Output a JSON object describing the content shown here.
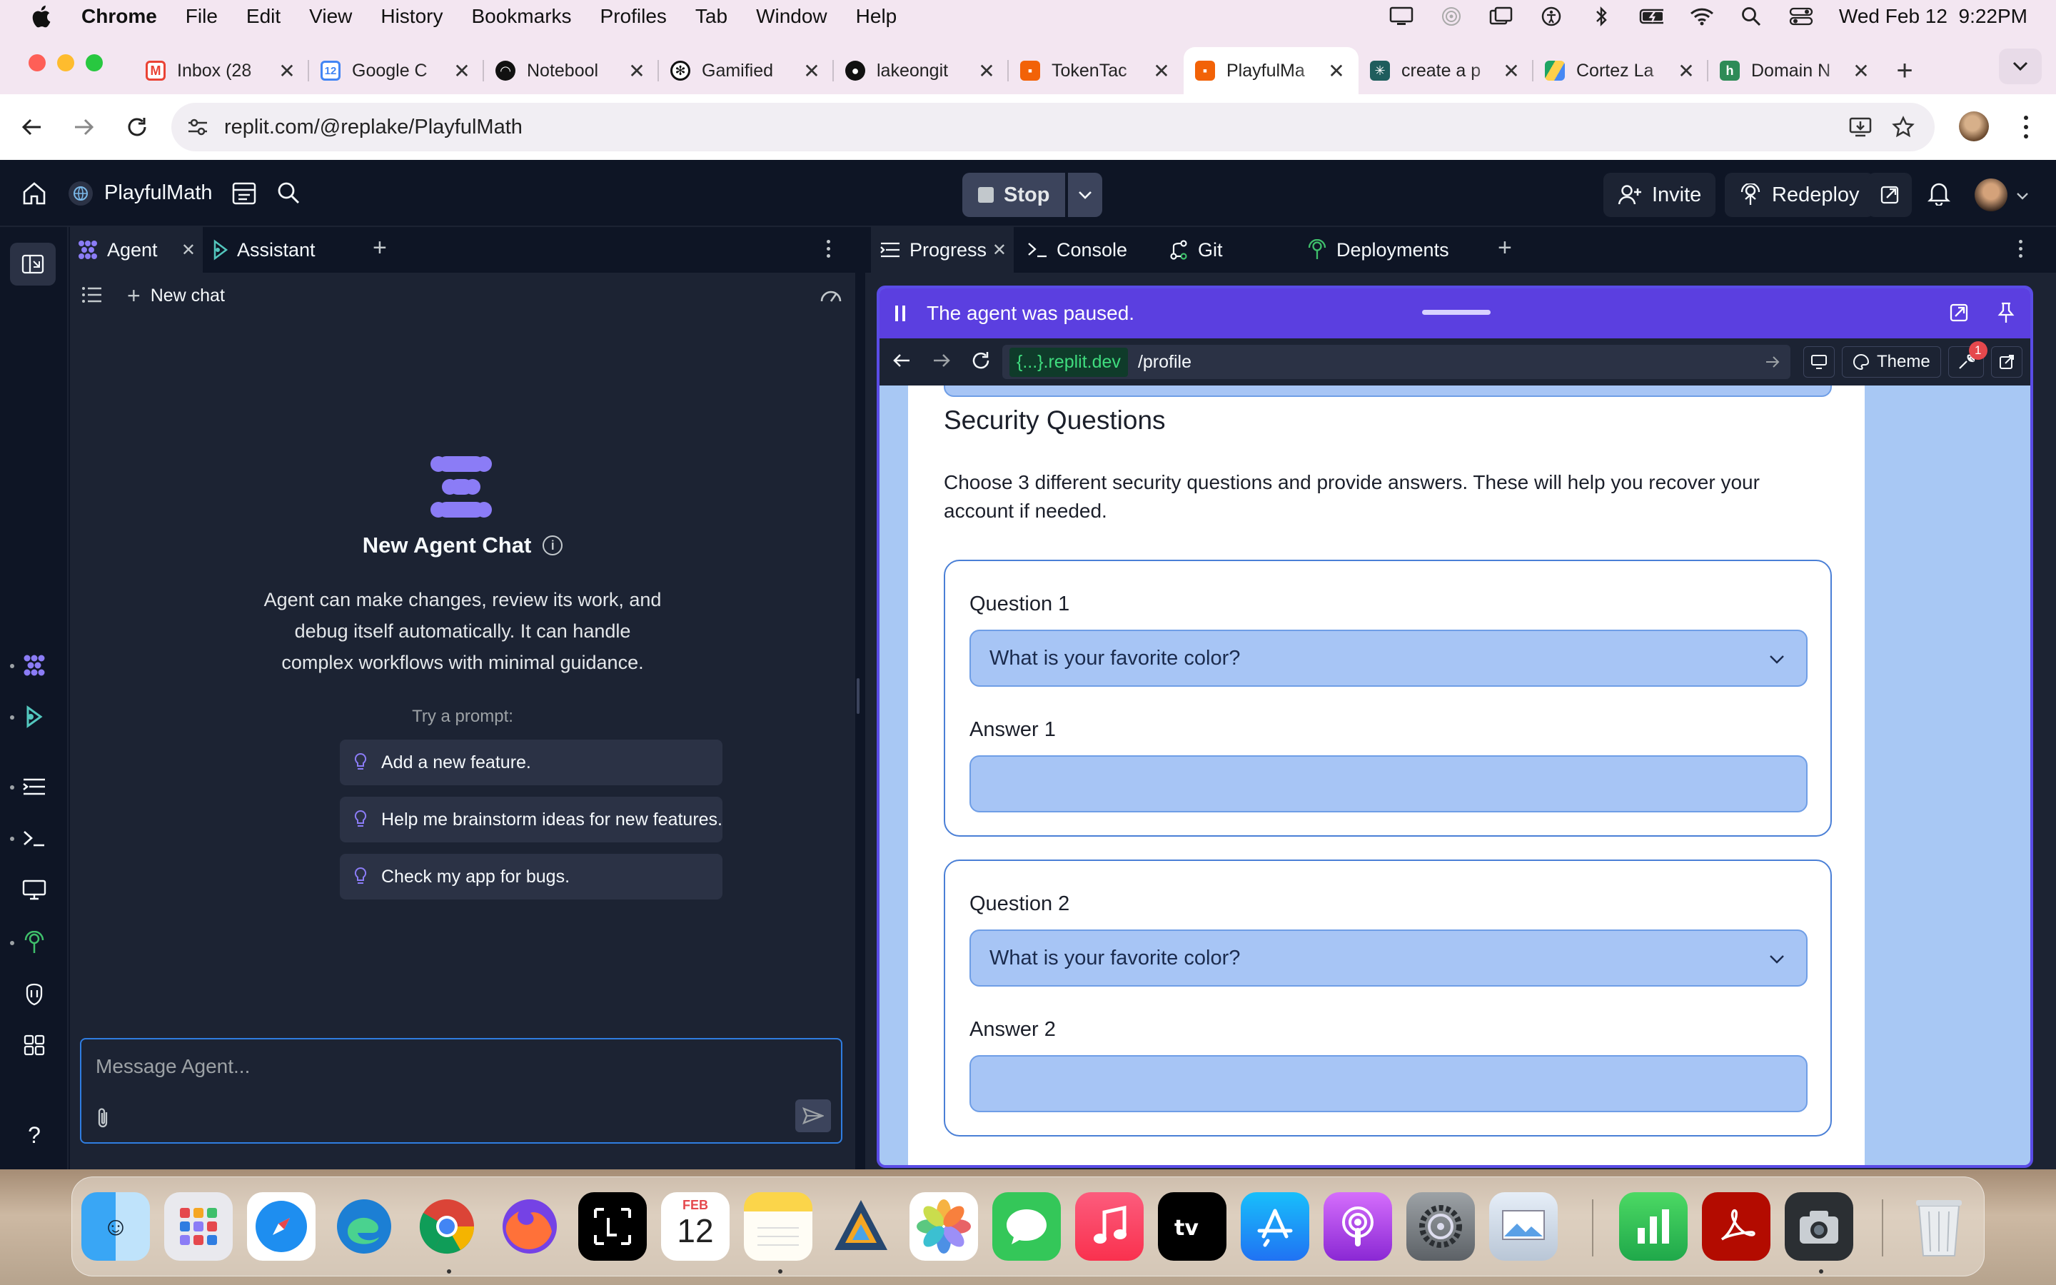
{
  "menubar": {
    "app_name": "Chrome",
    "items": [
      "File",
      "Edit",
      "View",
      "History",
      "Bookmarks",
      "Profiles",
      "Tab",
      "Window",
      "Help"
    ],
    "datetime": "Wed Feb 12  9:22PM"
  },
  "tabs": [
    {
      "title": "Inbox (28",
      "favicon": "gmail-icon",
      "color": "#ea4335"
    },
    {
      "title": "Google C",
      "favicon": "google-calendar-icon",
      "color": "#4285f4"
    },
    {
      "title": "Notebool",
      "favicon": "notebooklm-icon",
      "color": "#111111"
    },
    {
      "title": "Gamified",
      "favicon": "openai-icon",
      "color": "#111111"
    },
    {
      "title": "lakeongit",
      "favicon": "github-icon",
      "color": "#111111"
    },
    {
      "title": "TokenTac",
      "favicon": "replit-icon",
      "color": "#f26207"
    },
    {
      "title": "PlayfulMa",
      "favicon": "replit-icon",
      "color": "#f26207",
      "active": true
    },
    {
      "title": "create a p",
      "favicon": "perplexity-icon",
      "color": "#1f5d5d"
    },
    {
      "title": "Cortez La",
      "favicon": "google-drive-icon",
      "color": "#1fa463"
    },
    {
      "title": "Domain N",
      "favicon": "hover-icon",
      "color": "#2e8b57"
    }
  ],
  "addressbar": {
    "url": "replit.com/@replake/PlayfulMath"
  },
  "replit": {
    "project_name": "PlayfulMath",
    "stop_label": "Stop",
    "invite_label": "Invite",
    "redeploy_label": "Redeploy",
    "left_tabs": {
      "agent": "Agent",
      "assistant": "Assistant"
    },
    "new_chat": "New chat",
    "agent_title": "New Agent Chat",
    "agent_desc_lines": [
      "Agent can make changes, review its work, and",
      "debug itself automatically. It can handle",
      "complex workflows with minimal guidance."
    ],
    "try_prompt": "Try a prompt:",
    "suggestions": [
      "Add a new feature.",
      "Help me brainstorm ideas for new features.",
      "Check my app for bugs."
    ],
    "message_placeholder": "Message Agent...",
    "right_tabs": {
      "progress": "Progress",
      "console": "Console",
      "git": "Git",
      "deployments": "Deployments"
    },
    "paused_msg": "The agent was paused.",
    "dev_domain": "{...}.replit.dev",
    "dev_path": "/profile",
    "theme_label": "Theme",
    "notification_count": "1"
  },
  "profile_page": {
    "heading": "Security Questions",
    "desc_line1": "Choose 3 different security questions and provide answers. These will help you recover your",
    "desc_line2": "account if needed.",
    "q1_label": "Question 1",
    "q1_value": "What is your favorite color?",
    "a1_label": "Answer 1",
    "q2_label": "Question 2",
    "q2_value": "What is your favorite color?",
    "a2_label": "Answer 2"
  },
  "dock": {
    "calendar_month": "FEB",
    "calendar_day": "12"
  }
}
